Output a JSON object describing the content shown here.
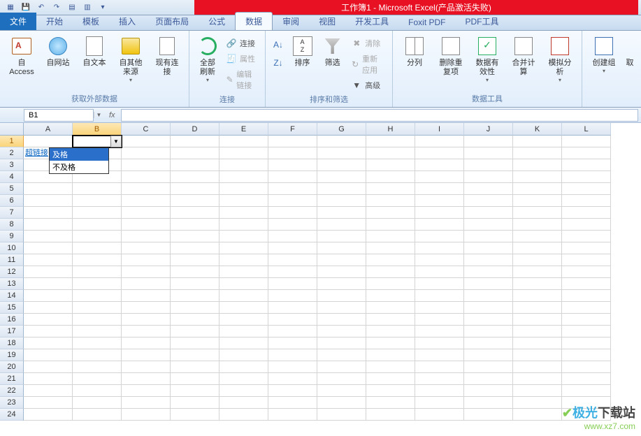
{
  "title_banner": "工作簿1 - Microsoft Excel(产品激活失败)",
  "tabs": {
    "file": "文件",
    "items": [
      "开始",
      "模板",
      "插入",
      "页面布局",
      "公式",
      "数据",
      "审阅",
      "视图",
      "开发工具",
      "Foxit PDF",
      "PDF工具"
    ],
    "active_index": 5
  },
  "ribbon": {
    "group_ext": {
      "label": "获取外部数据",
      "btn_access": "自 Access",
      "btn_web": "自网站",
      "btn_text": "自文本",
      "btn_other": "自其他来源",
      "btn_conn": "现有连接"
    },
    "group_conn": {
      "label": "连接",
      "btn_refresh": "全部刷新",
      "s_conn": "连接",
      "s_prop": "属性",
      "s_edit": "编辑链接"
    },
    "group_sort": {
      "label": "排序和筛选",
      "btn_sort": "排序",
      "btn_filter": "筛选",
      "s_clear": "清除",
      "s_reapply": "重新应用",
      "s_adv": "高级"
    },
    "group_tools": {
      "label": "数据工具",
      "btn_split": "分列",
      "btn_dup": "删除重复项",
      "btn_valid": "数据有效性",
      "btn_consol": "合并计算",
      "btn_whatif": "模拟分析"
    },
    "group_outline": {
      "btn_group": "创建组",
      "btn_ungroup": "取"
    }
  },
  "namebox": "B1",
  "columns": [
    "A",
    "B",
    "C",
    "D",
    "E",
    "F",
    "G",
    "H",
    "I",
    "J",
    "K",
    "L"
  ],
  "active_col_index": 1,
  "active_row_index": 0,
  "row_count": 24,
  "cells": {
    "A2": "超链接"
  },
  "validation_dropdown": {
    "items": [
      "及格",
      "不及格"
    ],
    "highlighted": 0
  },
  "watermark": {
    "line1_a": "极光",
    "line1_b": "下载站",
    "line2": "www.xz7.com"
  }
}
